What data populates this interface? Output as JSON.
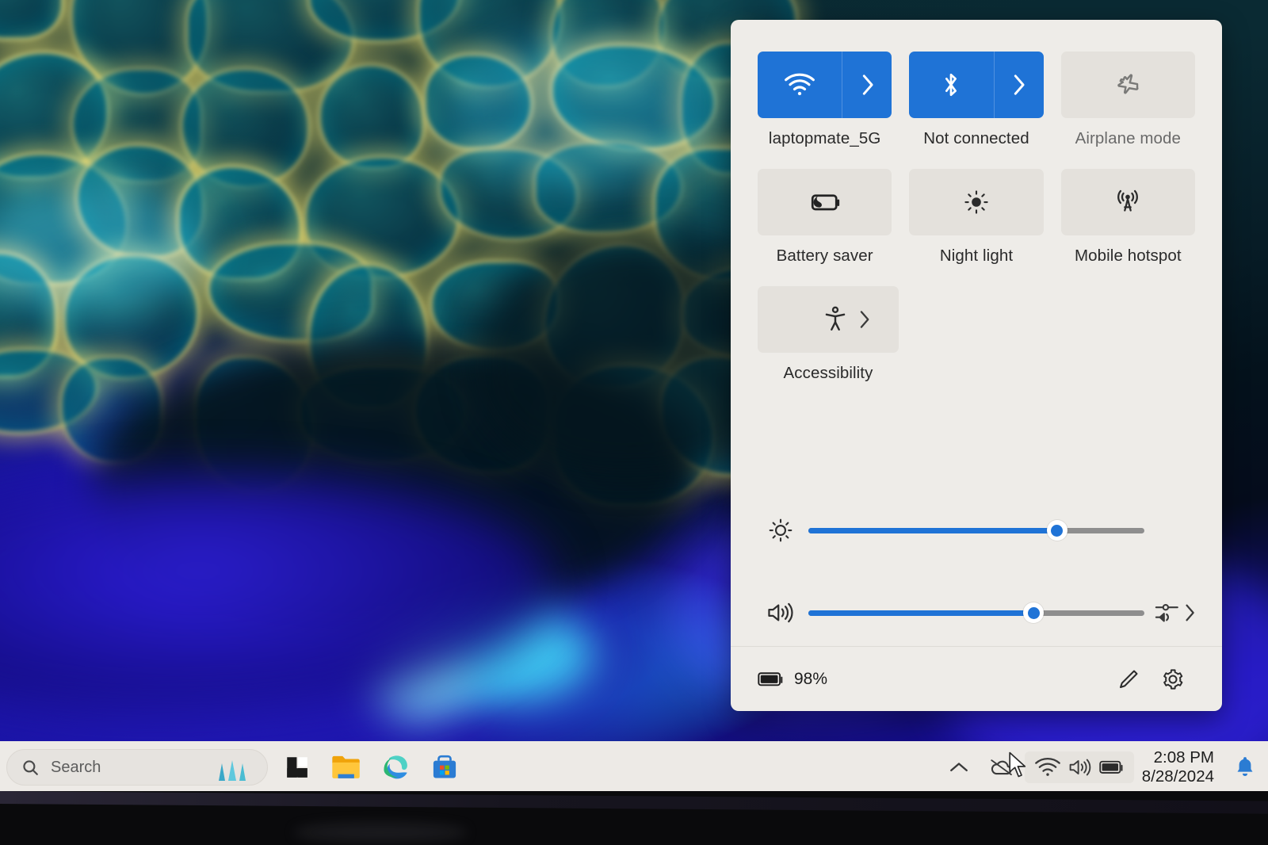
{
  "quick_settings": {
    "tiles": [
      {
        "id": "wifi",
        "label": "laptopmate_5G",
        "icon": "wifi-icon",
        "state": "on",
        "expandable": true
      },
      {
        "id": "bluetooth",
        "label": "Not connected",
        "icon": "bluetooth-icon",
        "state": "on",
        "expandable": true
      },
      {
        "id": "airplane",
        "label": "Airplane mode",
        "icon": "airplane-icon",
        "state": "off",
        "expandable": false
      },
      {
        "id": "battery-saver",
        "label": "Battery saver",
        "icon": "battery-saver-icon",
        "state": "off",
        "expandable": false
      },
      {
        "id": "night-light",
        "label": "Night light",
        "icon": "night-light-icon",
        "state": "off",
        "expandable": false
      },
      {
        "id": "mobile-hotspot",
        "label": "Mobile hotspot",
        "icon": "mobile-hotspot-icon",
        "state": "off",
        "expandable": false
      },
      {
        "id": "accessibility",
        "label": "Accessibility",
        "icon": "accessibility-icon",
        "state": "off",
        "expandable": true
      }
    ],
    "sliders": {
      "brightness": {
        "icon": "brightness-icon",
        "value": 74
      },
      "volume": {
        "icon": "volume-icon",
        "value": 67,
        "output_selector": "audio-output-icon"
      }
    },
    "footer": {
      "battery_icon": "battery-icon",
      "battery_percent": "98%",
      "edit_label": "pencil-icon",
      "settings_label": "gear-icon"
    },
    "accent_color": "#1f73d6",
    "panel_bg": "#eeece8"
  },
  "taskbar": {
    "search": {
      "placeholder": "Search",
      "icon": "search-icon"
    },
    "copilot_icon": "copilot-icon",
    "apps": [
      {
        "id": "start",
        "name": "start-icon"
      },
      {
        "id": "file-explorer",
        "name": "file-explorer-icon"
      },
      {
        "id": "edge",
        "name": "edge-icon"
      },
      {
        "id": "store",
        "name": "microsoft-store-icon"
      }
    ],
    "tray": {
      "overflow_icon": "chevron-up-icon",
      "onedrive_icon": "onedrive-offline-icon",
      "network_icon": "wifi-icon",
      "volume_icon": "volume-icon",
      "battery_icon": "battery-icon",
      "notification_icon": "bell-icon"
    },
    "clock": {
      "time": "2:08 PM",
      "date": "8/28/2024"
    }
  }
}
